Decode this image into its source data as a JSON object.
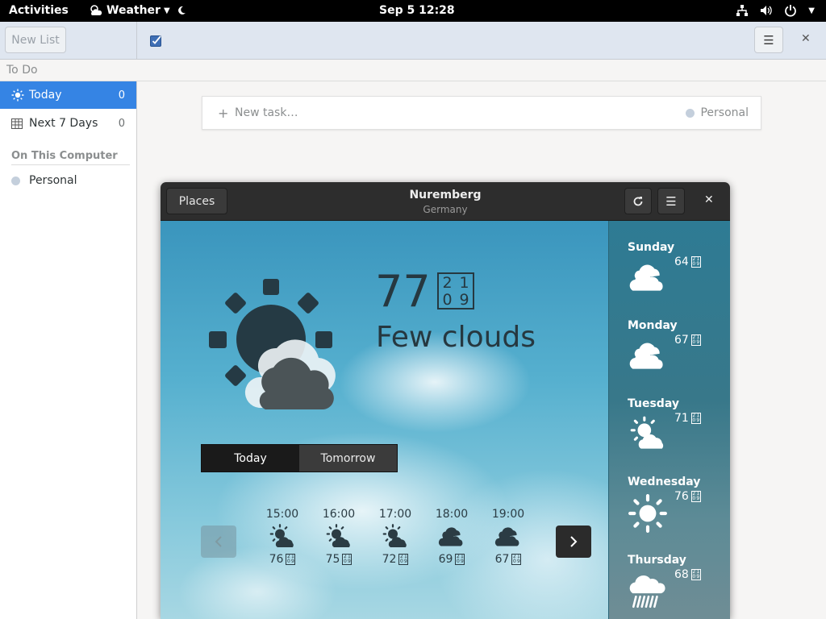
{
  "topbar": {
    "activities": "Activities",
    "app_name": "Weather",
    "clock": "Sep 5  12:28"
  },
  "todo": {
    "new_list_label": "New List",
    "window_title": "To Do",
    "sidebar": {
      "items": [
        {
          "label": "Today",
          "count": "0",
          "icon": "sun-icon",
          "active": true
        },
        {
          "label": "Next 7 Days",
          "count": "0",
          "icon": "calendar-icon",
          "active": false
        }
      ],
      "section_title": "On This Computer",
      "lists": [
        {
          "label": "Personal",
          "color": "#c4cfdc"
        }
      ]
    },
    "new_task": {
      "placeholder": "New task…",
      "list_name": "Personal"
    }
  },
  "weather": {
    "places_label": "Places",
    "location": "Nuremberg",
    "country": "Germany",
    "current": {
      "temperature": "77",
      "unit_glyph": [
        "2",
        "1",
        "0",
        "9"
      ],
      "condition": "Few clouds",
      "icon": "few-clouds-icon"
    },
    "tabs": [
      {
        "label": "Today",
        "selected": true
      },
      {
        "label": "Tomorrow",
        "selected": false
      }
    ],
    "hourly": [
      {
        "time": "15:00",
        "temp": "76",
        "icon": "few-clouds-icon"
      },
      {
        "time": "16:00",
        "temp": "75",
        "icon": "few-clouds-icon"
      },
      {
        "time": "17:00",
        "temp": "72",
        "icon": "few-clouds-icon"
      },
      {
        "time": "18:00",
        "temp": "69",
        "icon": "overcast-icon"
      },
      {
        "time": "19:00",
        "temp": "67",
        "icon": "overcast-icon"
      }
    ],
    "daily": [
      {
        "day": "Sunday",
        "temp": "64",
        "icon": "overcast-icon"
      },
      {
        "day": "Monday",
        "temp": "67",
        "icon": "overcast-icon"
      },
      {
        "day": "Tuesday",
        "temp": "71",
        "icon": "few-clouds-icon"
      },
      {
        "day": "Wednesday",
        "temp": "76",
        "icon": "clear-icon"
      },
      {
        "day": "Thursday",
        "temp": "68",
        "icon": "rain-icon"
      }
    ],
    "colors": {
      "accent": "#3584e4",
      "header": "#2d2d2d"
    }
  }
}
